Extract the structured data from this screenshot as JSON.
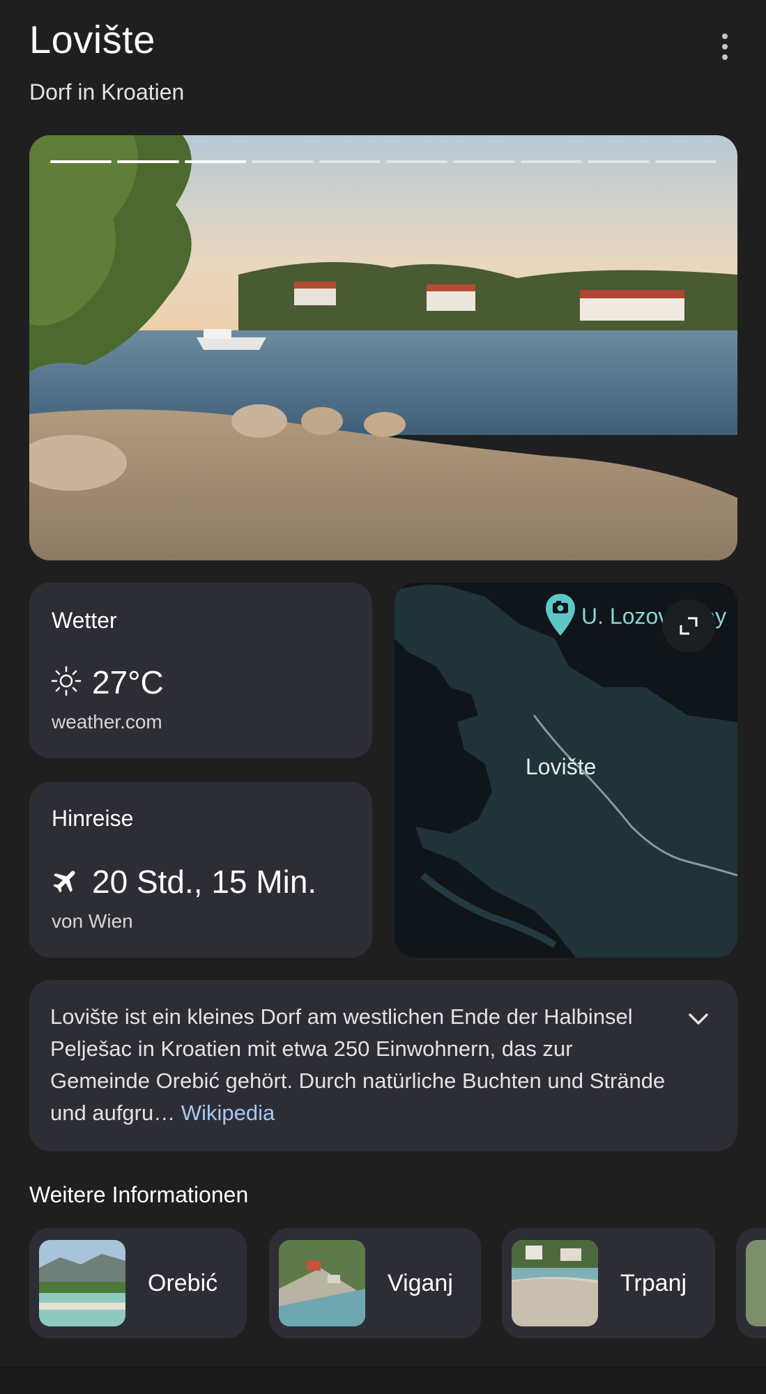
{
  "header": {
    "title": "Lovište",
    "subtitle": "Dorf in Kroatien",
    "menu_icon": "more-vert-icon"
  },
  "gallery": {
    "segments_total": 10,
    "segments_active": 3
  },
  "weather": {
    "label": "Wetter",
    "temperature": "27°C",
    "icon": "sun-icon",
    "source": "weather.com"
  },
  "travel": {
    "label": "Hinreise",
    "icon": "airplane-icon",
    "duration": "20 Std., 15 Min.",
    "from": "von Wien"
  },
  "map": {
    "place_label": "Lovište",
    "poi_label": "U. Lozova Bay",
    "poi_icon": "camera-pin-icon",
    "expand_icon": "expand-icon"
  },
  "description": {
    "text": "Lovište ist ein kleines Dorf am westlichen Ende der Halbinsel Pelješac in Kroatien mit etwa 250 Einwohnern, das zur Gemeinde Orebić gehört. Durch natürliche Buchten und Strände und aufgru…",
    "source_link": "Wikipedia",
    "expand_icon": "chevron-down-icon"
  },
  "more_info": {
    "title": "Weitere Informationen",
    "items": [
      {
        "label": "Orebić"
      },
      {
        "label": "Viganj"
      },
      {
        "label": "Trpanj"
      }
    ]
  }
}
